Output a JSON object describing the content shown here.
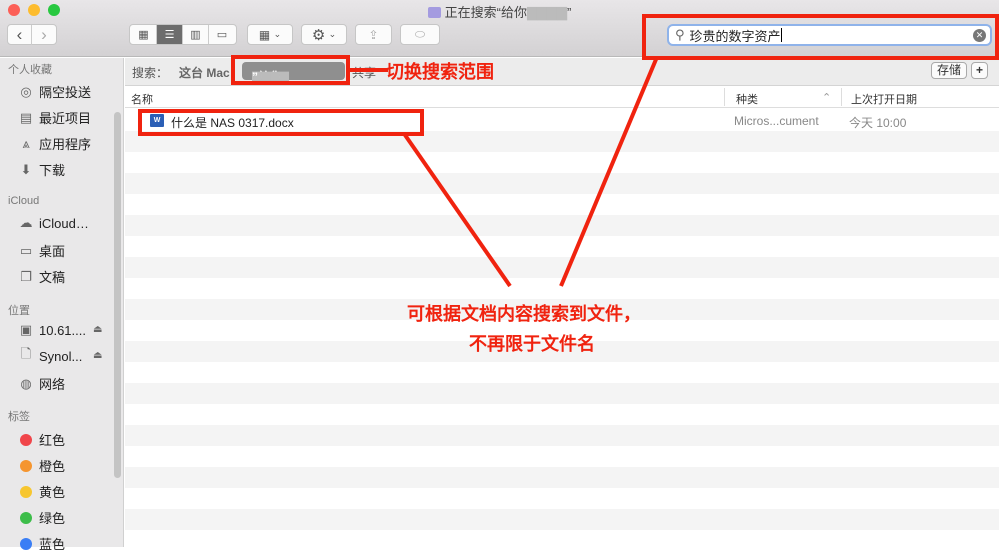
{
  "window": {
    "title": "正在搜索“给你",
    "title_suffix": "”"
  },
  "toolbar": {
    "back": "‹",
    "forward": "›",
    "views": [
      "icon",
      "list",
      "column",
      "gallery"
    ],
    "group": "group",
    "action": "gear",
    "share": "share",
    "tag": "tag"
  },
  "search": {
    "value": "珍贵的数字资产"
  },
  "sidebar": {
    "favorites_header": "个人收藏",
    "favorites": [
      {
        "label": "隔空投送",
        "icon": "airdrop-icon"
      },
      {
        "label": "最近项目",
        "icon": "recents-icon"
      },
      {
        "label": "应用程序",
        "icon": "applications-icon"
      },
      {
        "label": "下载",
        "icon": "downloads-icon"
      }
    ],
    "icloud_header": "iCloud",
    "icloud": [
      {
        "label": "iCloud…",
        "icon": "cloud-icon"
      },
      {
        "label": "桌面",
        "icon": "desktop-icon"
      },
      {
        "label": "文稿",
        "icon": "documents-icon"
      }
    ],
    "locations_header": "位置",
    "locations": [
      {
        "label": "10.61....",
        "icon": "monitor-icon"
      },
      {
        "label": "Synol...",
        "icon": "file-icon"
      },
      {
        "label": "网络",
        "icon": "network-icon"
      }
    ],
    "tags_header": "标签",
    "tags": [
      {
        "label": "红色",
        "color": "#f0454a"
      },
      {
        "label": "橙色",
        "color": "#f5952f"
      },
      {
        "label": "黄色",
        "color": "#f7c62f"
      },
      {
        "label": "绿色",
        "color": "#3dbd4a"
      },
      {
        "label": "蓝色",
        "color": "#3a7ef5"
      }
    ]
  },
  "scope": {
    "label": "搜索：",
    "this_mac": "这台 Mac",
    "selected": "“给你",
    "selected_end": "”",
    "shared": "共享",
    "save": "存储",
    "add": "+"
  },
  "columns": {
    "name": "名称",
    "kind": "种类",
    "last_opened": "上次打开日期"
  },
  "files": [
    {
      "name": "什么是 NAS 0317.docx",
      "kind": "Micros...cument",
      "last_opened": "今天 10:00",
      "icon": "W"
    }
  ],
  "annotations": {
    "scope": "切换搜索范围",
    "content_line1": "可根据文档内容搜索到文件，",
    "content_line2": "不再限于文件名"
  }
}
